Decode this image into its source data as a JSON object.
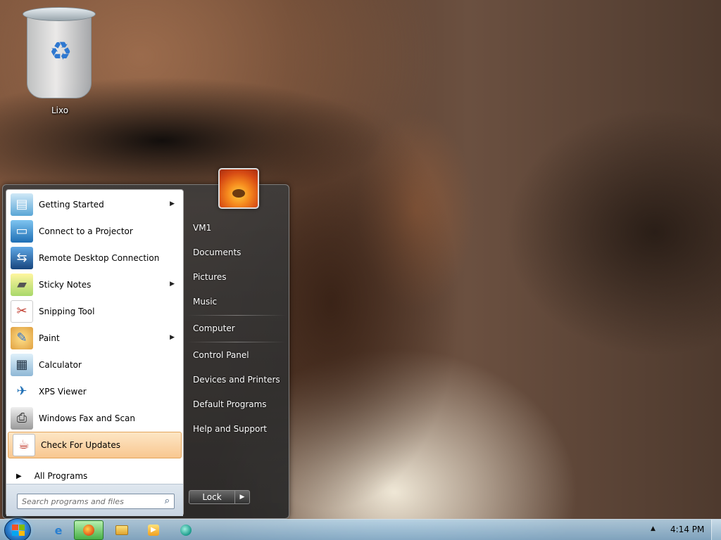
{
  "desktop": {
    "recycle_bin": {
      "label": "Lixo",
      "icon": "recycle-bin-icon"
    }
  },
  "start_menu": {
    "programs": [
      {
        "label": "Getting Started",
        "icon": "getting-started-icon",
        "has_submenu": true
      },
      {
        "label": "Connect to a Projector",
        "icon": "projector-icon",
        "has_submenu": false
      },
      {
        "label": "Remote Desktop Connection",
        "icon": "remote-desktop-icon",
        "has_submenu": false
      },
      {
        "label": "Sticky Notes",
        "icon": "sticky-notes-icon",
        "has_submenu": true
      },
      {
        "label": "Snipping Tool",
        "icon": "snipping-tool-icon",
        "has_submenu": false
      },
      {
        "label": "Paint",
        "icon": "paint-icon",
        "has_submenu": true
      },
      {
        "label": "Calculator",
        "icon": "calculator-icon",
        "has_submenu": false
      },
      {
        "label": "XPS Viewer",
        "icon": "xps-viewer-icon",
        "has_submenu": false
      },
      {
        "label": "Windows Fax and Scan",
        "icon": "fax-scan-icon",
        "has_submenu": false
      },
      {
        "label": "Check For Updates",
        "icon": "java-icon",
        "has_submenu": false,
        "highlighted": true
      }
    ],
    "all_programs_label": "All Programs",
    "search_placeholder": "Search programs and files",
    "right_links": {
      "user": "VM1",
      "documents": "Documents",
      "pictures": "Pictures",
      "music": "Music",
      "computer": "Computer",
      "control_panel": "Control Panel",
      "devices_printers": "Devices and Printers",
      "default_programs": "Default Programs",
      "help_support": "Help and Support"
    },
    "lock_label": "Lock"
  },
  "taskbar": {
    "pinned": [
      {
        "icon": "internet-explorer-icon"
      },
      {
        "icon": "firefox-icon",
        "active": true
      },
      {
        "icon": "file-explorer-icon"
      },
      {
        "icon": "media-player-icon"
      },
      {
        "icon": "network-globe-icon"
      }
    ],
    "clock": "4:14 PM"
  },
  "colors": {
    "highlight": "#f8c790",
    "taskbar": "#9fc1da",
    "menu_dark": "#2e2e2e"
  }
}
